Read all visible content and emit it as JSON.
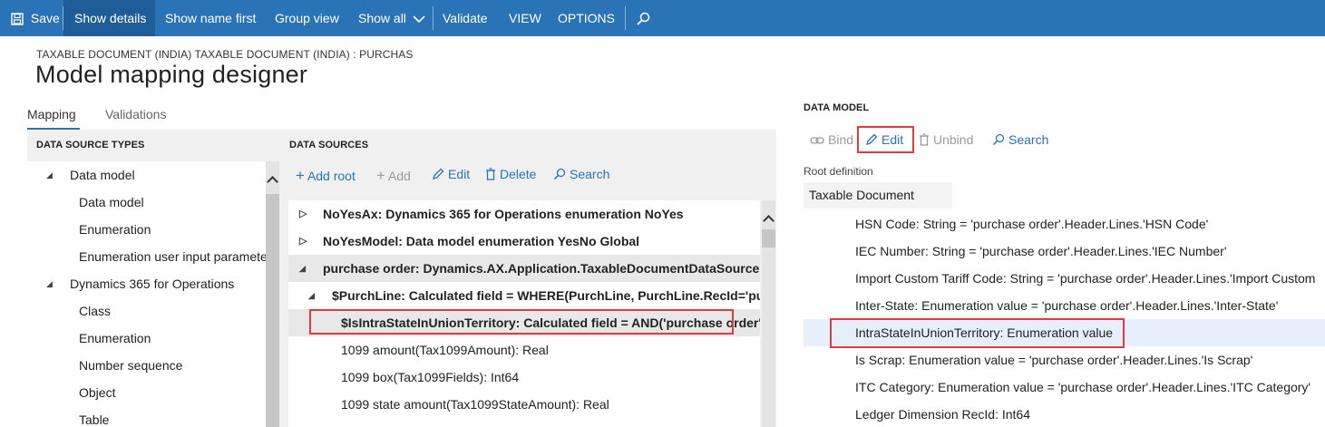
{
  "toolbar": {
    "save": "Save",
    "show_details": "Show details",
    "show_name_first": "Show name first",
    "group_view": "Group view",
    "show_all": "Show all",
    "validate": "Validate",
    "view": "VIEW",
    "options": "OPTIONS"
  },
  "header": {
    "breadcrumb": "TAXABLE DOCUMENT (INDIA) TAXABLE DOCUMENT (INDIA) : PURCHAS",
    "title": "Model mapping designer"
  },
  "tabs": {
    "mapping": "Mapping",
    "validations": "Validations"
  },
  "data_source_types": {
    "title": "DATA SOURCE TYPES",
    "items": [
      {
        "label": "Data model",
        "level": 0
      },
      {
        "label": "Data model",
        "level": 1
      },
      {
        "label": "Enumeration",
        "level": 1
      },
      {
        "label": "Enumeration user input paramete",
        "level": 1
      },
      {
        "label": "Dynamics 365 for Operations",
        "level": 0
      },
      {
        "label": "Class",
        "level": 1
      },
      {
        "label": "Enumeration",
        "level": 1
      },
      {
        "label": "Number sequence",
        "level": 1
      },
      {
        "label": "Object",
        "level": 1
      },
      {
        "label": "Table",
        "level": 1
      }
    ]
  },
  "data_sources": {
    "title": "DATA SOURCES",
    "toolbar": {
      "add_root": "Add root",
      "add": "Add",
      "edit": "Edit",
      "delete": "Delete",
      "search": "Search"
    },
    "items": [
      {
        "label": "NoYesAx: Dynamics 365 for Operations enumeration NoYes"
      },
      {
        "label": "NoYesModel: Data model enumeration YesNo Global"
      },
      {
        "label": "purchase order: Dynamics.AX.Application.TaxableDocumentDataSourceHand"
      },
      {
        "label": "$PurchLine: Calculated field = WHERE(PurchLine, PurchLine.RecId='purcha"
      },
      {
        "label": "$IsIntraStateInUnionTerritory: Calculated field = AND('purchase order'.'$I"
      },
      {
        "label": "1099 amount(Tax1099Amount): Real"
      },
      {
        "label": "1099 box(Tax1099Fields): Int64"
      },
      {
        "label": "1099 state amount(Tax1099StateAmount): Real"
      }
    ]
  },
  "data_model": {
    "title": "DATA MODEL",
    "toolbar": {
      "bind": "Bind",
      "edit": "Edit",
      "unbind": "Unbind",
      "search": "Search"
    },
    "root_definition_label": "Root definition",
    "root_definition_value": "Taxable Document",
    "items": [
      {
        "label": "HSN Code: String = 'purchase order'.Header.Lines.'HSN Code'"
      },
      {
        "label": "IEC Number: String = 'purchase order'.Header.Lines.'IEC Number'"
      },
      {
        "label": "Import Custom Tariff Code: String = 'purchase order'.Header.Lines.'Import Custom"
      },
      {
        "label": "Inter-State: Enumeration value = 'purchase order'.Header.Lines.'Inter-State'"
      },
      {
        "label": "IntraStateInUnionTerritory: Enumeration value"
      },
      {
        "label": "Is Scrap: Enumeration value = 'purchase order'.Header.Lines.'Is Scrap'"
      },
      {
        "label": "ITC Category: Enumeration value = 'purchase order'.Header.Lines.'ITC Category'"
      },
      {
        "label": "Ledger Dimension RecId: Int64"
      }
    ]
  },
  "colors": {
    "actionbar": "#2b73b7",
    "accent": "#2b73b7",
    "highlight": "#e03c3c",
    "selected_row": "#e6effb"
  }
}
